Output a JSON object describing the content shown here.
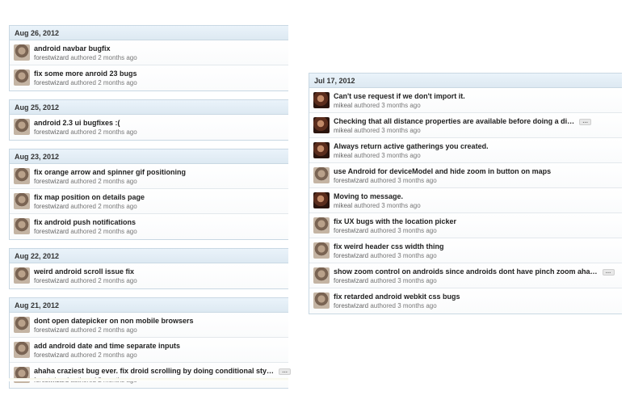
{
  "left_groups": [
    {
      "date": "Aug 26, 2012",
      "commits": [
        {
          "message": "android navbar bugfix",
          "author": "forestwizard",
          "action": "authored",
          "time": "2 months ago",
          "avatar": "forest"
        },
        {
          "message": "fix some more anroid 23 bugs",
          "author": "forestwizard",
          "action": "authored",
          "time": "2 months ago",
          "avatar": "forest"
        }
      ]
    },
    {
      "date": "Aug 25, 2012",
      "commits": [
        {
          "message": "android 2.3 ui bugfixes :(",
          "author": "forestwizard",
          "action": "authored",
          "time": "2 months ago",
          "avatar": "forest"
        }
      ]
    },
    {
      "date": "Aug 23, 2012",
      "commits": [
        {
          "message": "fix orange arrow and spinner gif positioning",
          "author": "forestwizard",
          "action": "authored",
          "time": "2 months ago",
          "avatar": "forest"
        },
        {
          "message": "fix map position on details page",
          "author": "forestwizard",
          "action": "authored",
          "time": "2 months ago",
          "avatar": "forest"
        },
        {
          "message": "fix android push notifications",
          "author": "forestwizard",
          "action": "authored",
          "time": "2 months ago",
          "avatar": "forest"
        }
      ]
    },
    {
      "date": "Aug 22, 2012",
      "commits": [
        {
          "message": "weird android scroll issue fix",
          "author": "forestwizard",
          "action": "authored",
          "time": "2 months ago",
          "avatar": "forest"
        }
      ]
    },
    {
      "date": "Aug 21, 2012",
      "commits": [
        {
          "message": "dont open datepicker on non mobile browsers",
          "author": "forestwizard",
          "action": "authored",
          "time": "2 months ago",
          "avatar": "forest"
        },
        {
          "message": "add android date and time separate inputs",
          "author": "forestwizard",
          "action": "authored",
          "time": "2 months ago",
          "avatar": "forest"
        },
        {
          "message": "ahaha craziest bug ever. fix droid scrolling by doing conditional sty…",
          "author": "forestwizard",
          "action": "authored",
          "time": "2 months ago",
          "avatar": "forest",
          "truncated": true
        }
      ]
    }
  ],
  "right_groups": [
    {
      "date": "Jul 17, 2012",
      "commits": [
        {
          "message": "Can't use request if we don't import it.",
          "author": "mikeal",
          "action": "authored",
          "time": "3 months ago",
          "avatar": "mikeal"
        },
        {
          "message": "Checking that all distance properties are available before doing a di…",
          "author": "mikeal",
          "action": "authored",
          "time": "3 months ago",
          "avatar": "mikeal",
          "truncated": true
        },
        {
          "message": "Always return active gatherings you created.",
          "author": "mikeal",
          "action": "authored",
          "time": "3 months ago",
          "avatar": "mikeal"
        },
        {
          "message": "use Android for deviceModel and hide zoom in button on maps",
          "author": "forestwizard",
          "action": "authored",
          "time": "3 months ago",
          "avatar": "forest"
        },
        {
          "message": "Moving to message.",
          "author": "mikeal",
          "action": "authored",
          "time": "3 months ago",
          "avatar": "mikeal"
        },
        {
          "message": "fix UX bugs with the location picker",
          "author": "forestwizard",
          "action": "authored",
          "time": "3 months ago",
          "avatar": "forest"
        },
        {
          "message": "fix weird header css width thing",
          "author": "forestwizard",
          "action": "authored",
          "time": "3 months ago",
          "avatar": "forest"
        },
        {
          "message": "show zoom control on androids since androids dont have pinch zoom aha…",
          "author": "forestwizard",
          "action": "authored",
          "time": "3 months ago",
          "avatar": "forest",
          "truncated": true
        },
        {
          "message": "fix retarded android webkit css bugs",
          "author": "forestwizard",
          "action": "authored",
          "time": "3 months ago",
          "avatar": "forest"
        }
      ]
    }
  ],
  "ellipsis_label": "…"
}
